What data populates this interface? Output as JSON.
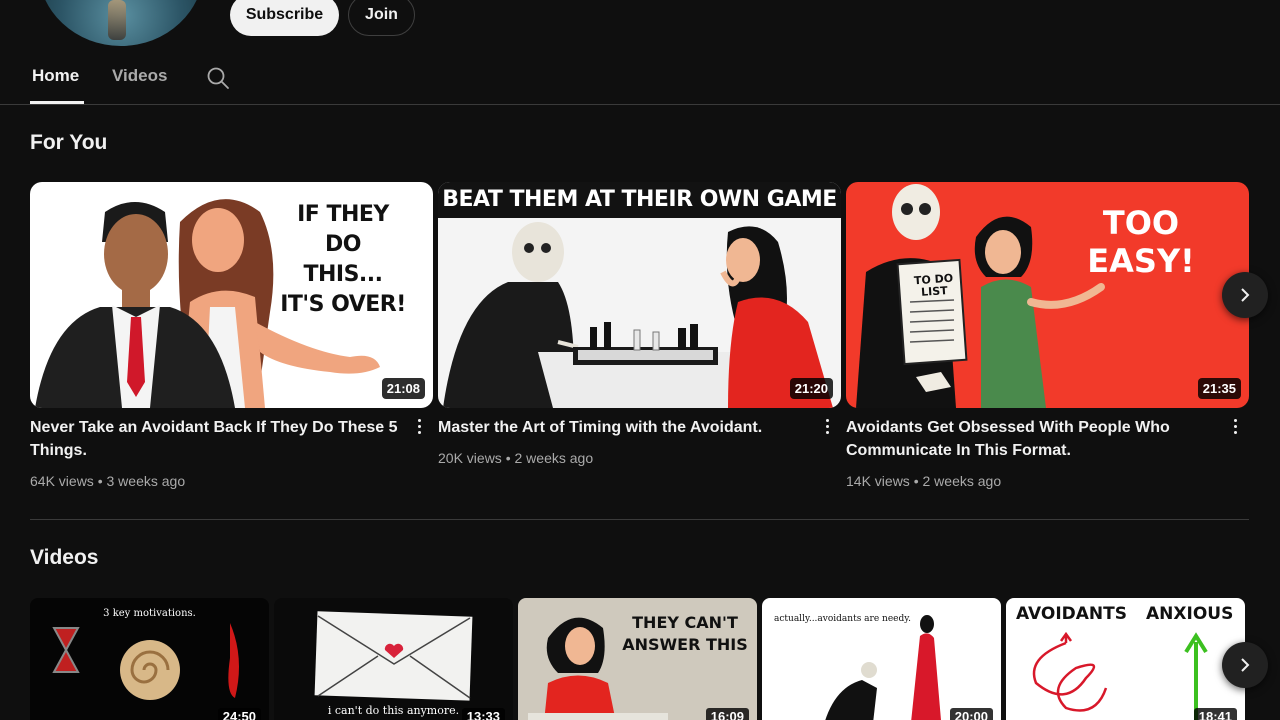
{
  "header": {
    "subscribe_label": "Subscribe",
    "join_label": "Join"
  },
  "tabs": [
    {
      "label": "Home",
      "active": true
    },
    {
      "label": "Videos",
      "active": false
    }
  ],
  "for_you": {
    "title": "For You",
    "videos": [
      {
        "title": "Never Take an Avoidant Back If They Do These 5 Things.",
        "views": "64K views",
        "age": "3 weeks ago",
        "duration": "21:08",
        "thumb_text": [
          "IF THEY DO",
          "THIS...",
          "IT'S OVER!"
        ]
      },
      {
        "title": "Master the Art of Timing with the Avoidant.",
        "views": "20K views",
        "age": "2 weeks ago",
        "duration": "21:20",
        "thumb_text": [
          "BEAT THEM AT THEIR OWN GAME"
        ]
      },
      {
        "title": "Avoidants Get Obsessed With People Who Communicate In This Format.",
        "views": "14K views",
        "age": "2 weeks ago",
        "duration": "21:35",
        "thumb_text": [
          "TOO EASY!",
          "TO DO",
          "LIST"
        ]
      }
    ],
    "meta_separator": "•"
  },
  "videos_section": {
    "title": "Videos",
    "items": [
      {
        "duration": "24:50",
        "thumb_text": [
          "3 key motivations."
        ]
      },
      {
        "duration": "13:33",
        "thumb_text": [
          "i can't do this anymore."
        ]
      },
      {
        "duration": "16:09",
        "thumb_text": [
          "THEY CAN'T",
          "ANSWER THIS"
        ]
      },
      {
        "duration": "20:00",
        "thumb_text": [
          "actually...avoidants are needy."
        ]
      },
      {
        "duration": "18:41",
        "thumb_text": [
          "AVOIDANTS",
          "ANXIOUS"
        ]
      }
    ]
  },
  "colors": {
    "background": "#0f0f0f",
    "text_primary": "#f1f1f1",
    "text_secondary": "#aaaaaa",
    "thumb_red": "#f23a2a"
  },
  "icons": {
    "search": "search-icon",
    "more": "more-vert-icon",
    "next": "chevron-right-icon"
  }
}
